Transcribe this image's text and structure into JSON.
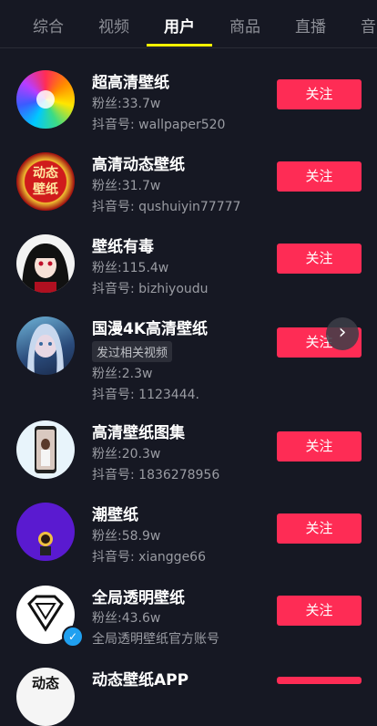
{
  "tabs": [
    {
      "label": "综合"
    },
    {
      "label": "视频"
    },
    {
      "label": "用户"
    },
    {
      "label": "商品"
    },
    {
      "label": "直播"
    },
    {
      "label": "音"
    }
  ],
  "active_tab_index": 2,
  "follow_label": "关注",
  "users": [
    {
      "name": "超高清壁纸",
      "fans": "粉丝:33.7w",
      "id": "抖音号: wallpaper520"
    },
    {
      "name": "高清动态壁纸",
      "fans": "粉丝:31.7w",
      "id": "抖音号: qushuiyin77777",
      "avatar_text": [
        "动态",
        "壁纸"
      ]
    },
    {
      "name": "壁纸有毒",
      "fans": "粉丝:115.4w",
      "id": "抖音号: bizhiyoudu"
    },
    {
      "name": "国漫4K高清壁纸",
      "tag": "发过相关视频",
      "fans": "粉丝:2.3w",
      "id": "抖音号: 1123444."
    },
    {
      "name": "高清壁纸图集",
      "fans": "粉丝:20.3w",
      "id": "抖音号: 1836278956"
    },
    {
      "name": "潮壁纸",
      "fans": "粉丝:58.9w",
      "id": "抖音号: xiangge66"
    },
    {
      "name": "全局透明壁纸",
      "fans": "粉丝:43.6w",
      "id": "全局透明壁纸官方账号"
    },
    {
      "name": "动态壁纸APP",
      "avatar_text": [
        "动态"
      ]
    }
  ]
}
